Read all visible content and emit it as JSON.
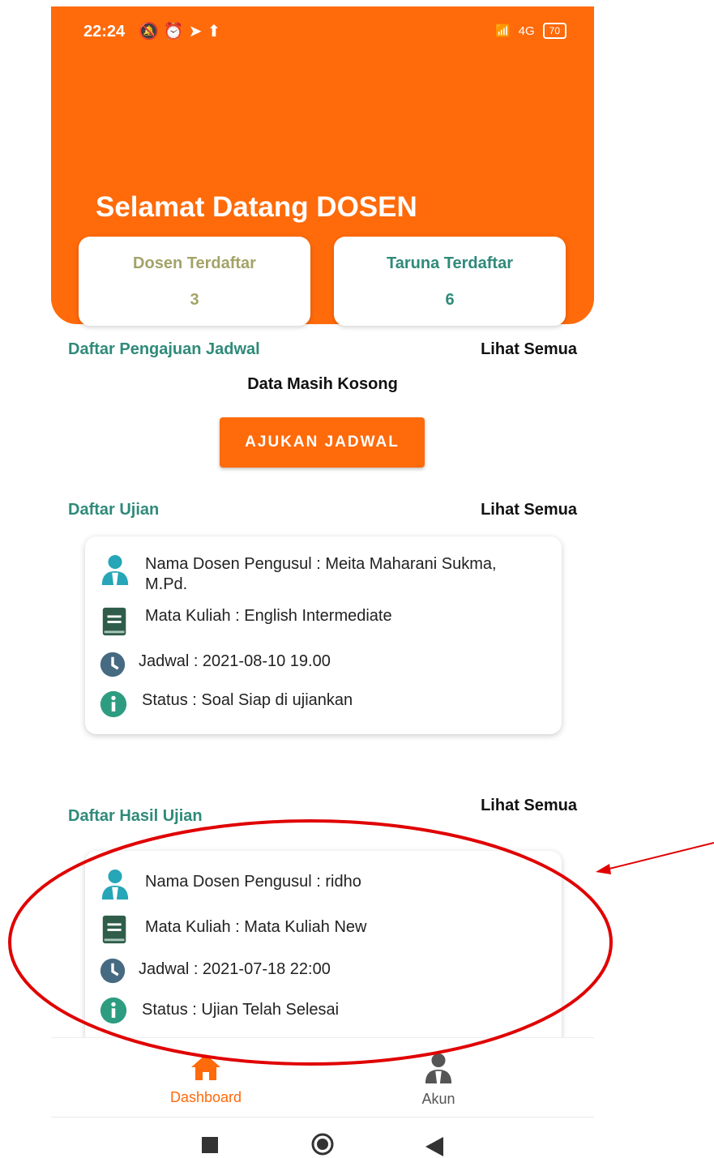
{
  "status_bar": {
    "time": "22:24",
    "network": "4G",
    "battery": "70"
  },
  "header": {
    "welcome": "Selamat Datang DOSEN"
  },
  "stats": [
    {
      "label": "Dosen Terdaftar",
      "value": "3"
    },
    {
      "label": "Taruna Terdaftar",
      "value": "6"
    }
  ],
  "schedule_requests": {
    "title": "Daftar Pengajuan Jadwal",
    "see_all": "Lihat Semua",
    "empty": "Data Masih Kosong",
    "button": "AJUKAN JADWAL"
  },
  "exams": {
    "title": "Daftar Ujian",
    "see_all": "Lihat Semua",
    "card": {
      "lecturer": "Nama Dosen Pengusul : Meita Maharani Sukma, M.Pd.",
      "course": "Mata Kuliah : English Intermediate",
      "schedule": "Jadwal : 2021-08-10 19.00",
      "status": "Status : Soal Siap di ujiankan"
    }
  },
  "results": {
    "title": "Daftar Hasil Ujian",
    "see_all": "Lihat Semua",
    "card": {
      "lecturer": "Nama Dosen Pengusul : ridho",
      "course": "Mata Kuliah : Mata Kuliah New",
      "schedule": "Jadwal : 2021-07-18 22:00",
      "status": "Status : Ujian Telah Selesai"
    }
  },
  "bottom_nav": [
    {
      "label": "Dashboard",
      "icon": "home-icon",
      "active": true
    },
    {
      "label": "Akun",
      "icon": "user-icon",
      "active": false
    }
  ],
  "colors": {
    "accent": "#ff6a0a",
    "teal": "#2f8a7a",
    "olive": "#a3a36a",
    "annotation": "#e00000"
  }
}
